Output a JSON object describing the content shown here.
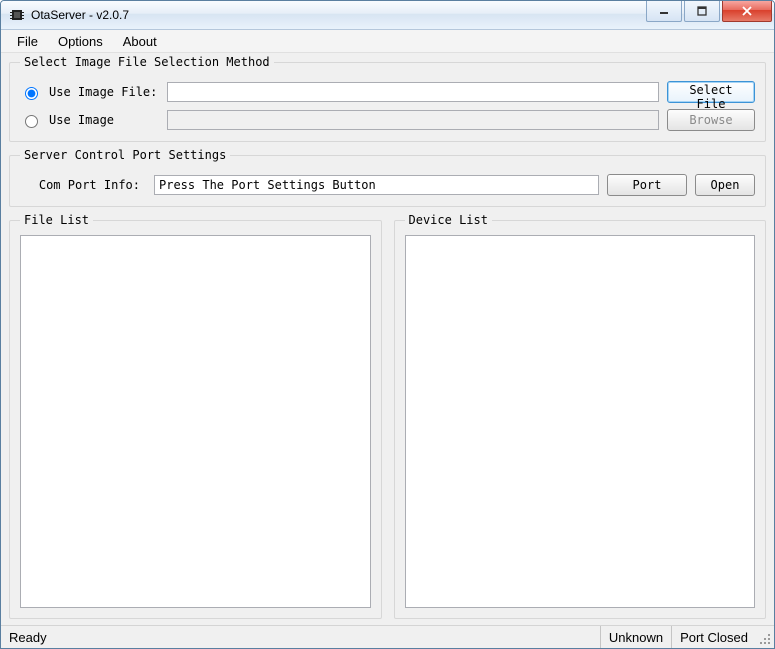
{
  "window": {
    "title": "OtaServer - v2.0.7"
  },
  "menu": {
    "file": "File",
    "options": "Options",
    "about": "About"
  },
  "group1": {
    "legend": "Select Image File Selection Method",
    "radio1_label": "Use Image File:",
    "radio2_label": "Use Image",
    "select_file_btn": "Select File",
    "browse_btn": "Browse",
    "file_value": "",
    "image_value": ""
  },
  "group2": {
    "legend": "Server Control Port Settings",
    "com_port_label": "Com Port Info:",
    "com_port_value": "Press The Port Settings Button",
    "port_btn": "Port",
    "open_btn": "Open"
  },
  "file_list": {
    "legend": "File List"
  },
  "device_list": {
    "legend": "Device List"
  },
  "status": {
    "ready": "Ready",
    "unknown": "Unknown",
    "port_closed": "Port Closed"
  }
}
